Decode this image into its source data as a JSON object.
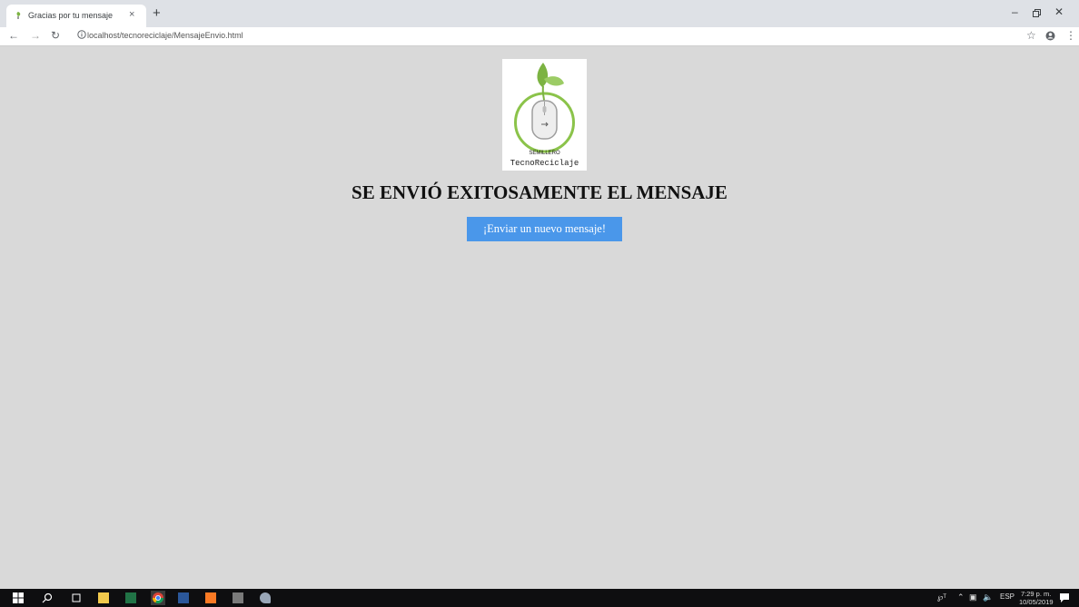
{
  "browser": {
    "tab_title": "Gracias por tu mensaje",
    "tab_close": "×",
    "new_tab": "+",
    "address": "localhost/tecnoreciclaje/MensajeEnvio.html",
    "icons": [
      "back-icon",
      "forward-icon",
      "reload-icon",
      "info-icon",
      "star-icon",
      "account-icon",
      "menu-icon"
    ],
    "window_controls": [
      "minimize-icon",
      "restore-icon",
      "close-icon"
    ]
  },
  "page": {
    "logo": {
      "top_text": "SEMILLERO",
      "bottom_text": "TecnoReciclaje"
    },
    "heading": "SE ENVIÓ EXITOSAMENTE EL MENSAJE",
    "button_label": "¡Enviar un nuevo mensaje!",
    "button_color": "#4a97ea",
    "background_color": "#d9d9d9"
  },
  "taskbar": {
    "apps": [
      "windows-start-icon",
      "search-icon",
      "task-view-icon",
      "file-explorer-icon",
      "excel-icon",
      "chrome-icon",
      "word-icon",
      "xampp-icon",
      "app-icon",
      "app-icon"
    ],
    "language": "ESP",
    "time": "7:29 p. m.",
    "date": "10/05/2019"
  }
}
